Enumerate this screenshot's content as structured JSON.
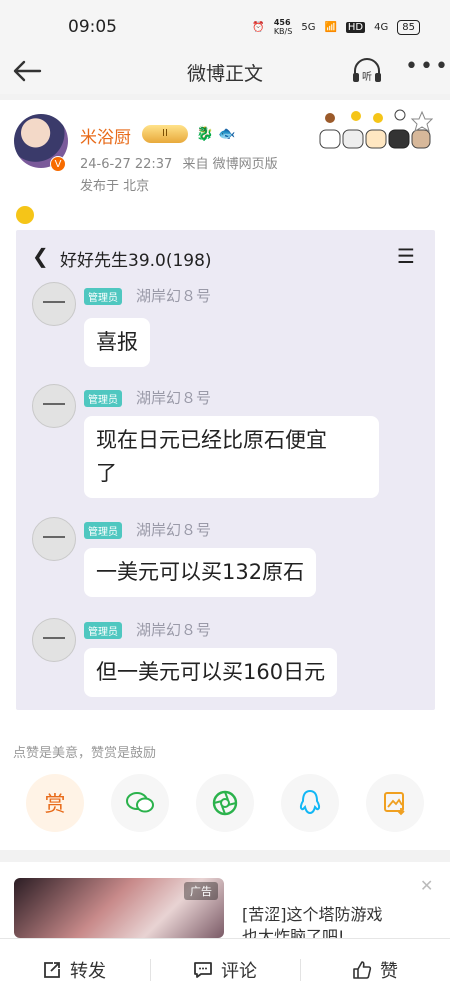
{
  "status_bar": {
    "time": "09:05",
    "net_speed": "456",
    "net_unit": "KB/S",
    "signal": "5G",
    "hd": "HD",
    "signal2": "4G",
    "battery": "85"
  },
  "nav": {
    "title": "微博正文",
    "listen_label": "听"
  },
  "post": {
    "username": "米浴厨",
    "level_badge": "II",
    "timestamp": "24-6-27 22:37",
    "source": "来自 微博网页版",
    "location": "发布于 北京"
  },
  "chat_screenshot": {
    "group_title": "好好先生39.0(198)",
    "messages": [
      {
        "role": "管理员",
        "sender": "湖岸幻８号",
        "text": "喜报"
      },
      {
        "role": "管理员",
        "sender": "湖岸幻８号",
        "text_line1": "现在日元已经比原石便宜",
        "text_line2": "了"
      },
      {
        "role": "管理员",
        "sender": "湖岸幻８号",
        "text": "一美元可以买132原石"
      },
      {
        "role": "管理员",
        "sender": "湖岸幻８号",
        "text": "但一美元可以买160日元"
      }
    ]
  },
  "encourage_text": "点赞是美意，赞赏是鼓励",
  "actions": {
    "reward_label": "赏"
  },
  "ad": {
    "tag": "广告",
    "text_line1": "[苦涩]这个塔防游戏",
    "text_line2": "也太炸脑了吧!"
  },
  "tabbar": {
    "repost": "转发",
    "comment": "评论",
    "like": "赞"
  },
  "colors": {
    "accent_orange": "#e86b1a",
    "role_teal": "#4fc7c0",
    "wechat_green": "#2bb24c",
    "qq_blue": "#12b7f5"
  }
}
